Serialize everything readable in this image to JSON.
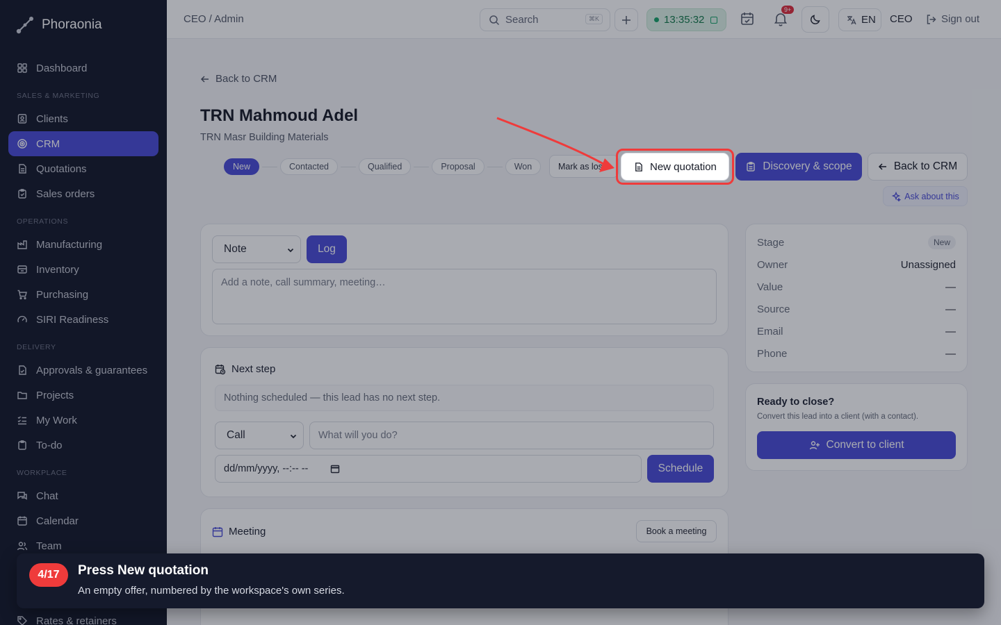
{
  "app": {
    "name": "Phoraonia"
  },
  "sidebar": {
    "items_top": [
      {
        "label": "Dashboard",
        "icon": "grid-icon"
      }
    ],
    "sections": [
      {
        "title": "SALES & MARKETING",
        "items": [
          {
            "label": "Clients",
            "icon": "contact-icon"
          },
          {
            "label": "CRM",
            "icon": "target-icon",
            "active": true
          },
          {
            "label": "Quotations",
            "icon": "document-icon"
          },
          {
            "label": "Sales orders",
            "icon": "clipboard-icon"
          }
        ]
      },
      {
        "title": "OPERATIONS",
        "items": [
          {
            "label": "Manufacturing",
            "icon": "factory-icon"
          },
          {
            "label": "Inventory",
            "icon": "archive-icon"
          },
          {
            "label": "Purchasing",
            "icon": "cart-icon"
          },
          {
            "label": "SIRI Readiness",
            "icon": "gauge-icon"
          }
        ]
      },
      {
        "title": "DELIVERY",
        "items": [
          {
            "label": "Approvals & guarantees",
            "icon": "file-check-icon"
          },
          {
            "label": "Projects",
            "icon": "folder-icon"
          },
          {
            "label": "My Work",
            "icon": "list-check-icon"
          },
          {
            "label": "To-do",
            "icon": "clipboard-check-icon"
          }
        ]
      },
      {
        "title": "WORKPLACE",
        "items": [
          {
            "label": "Chat",
            "icon": "chat-icon"
          },
          {
            "label": "Calendar",
            "icon": "calendar-icon"
          },
          {
            "label": "Team",
            "icon": "users-icon"
          }
        ]
      }
    ],
    "bottom_item": {
      "label": "Rates & retainers"
    }
  },
  "topbar": {
    "breadcrumb": "CEO / Admin",
    "search_label": "Search",
    "search_kbd": "⌘K",
    "timer": "13:35:32",
    "notification_badge": "9+",
    "language": "EN",
    "role": "CEO",
    "signout": "Sign out"
  },
  "page": {
    "back_link": "Back to CRM",
    "title": "TRN Mahmoud Adel",
    "subtitle": "TRN Masr Building Materials",
    "stages": [
      "New",
      "Contacted",
      "Qualified",
      "Proposal",
      "Won"
    ],
    "current_stage": "New",
    "mark_lost": "Mark as lost",
    "actions": {
      "new_quotation": "New quotation",
      "discovery": "Discovery & scope",
      "back": "Back to CRM",
      "ask": "Ask about this"
    }
  },
  "log_card": {
    "type_value": "Note",
    "log_button": "Log",
    "placeholder": "Add a note, call summary, meeting…"
  },
  "next_step": {
    "title": "Next step",
    "empty": "Nothing scheduled — this lead has no next step.",
    "type_value": "Call",
    "what_placeholder": "What will you do?",
    "date_placeholder": "dd/mm/yyyy, --:-- --",
    "schedule_button": "Schedule"
  },
  "meeting": {
    "title": "Meeting",
    "book_button": "Book a meeting"
  },
  "details": {
    "rows": [
      {
        "key": "Stage",
        "value": "New"
      },
      {
        "key": "Owner",
        "value": "Unassigned"
      },
      {
        "key": "Value",
        "value": "—"
      },
      {
        "key": "Source",
        "value": "—"
      },
      {
        "key": "Email",
        "value": "—"
      },
      {
        "key": "Phone",
        "value": "—"
      }
    ]
  },
  "close_card": {
    "title": "Ready to close?",
    "desc": "Convert this lead into a client (with a contact).",
    "button": "Convert to client"
  },
  "tour": {
    "step": "4/17",
    "title": "Press New quotation",
    "desc": "An empty offer, numbered by the workspace's own series."
  },
  "colors": {
    "accent": "#4a4bd6",
    "highlight": "#ef3b3b",
    "sidebar_bg": "#141829"
  }
}
